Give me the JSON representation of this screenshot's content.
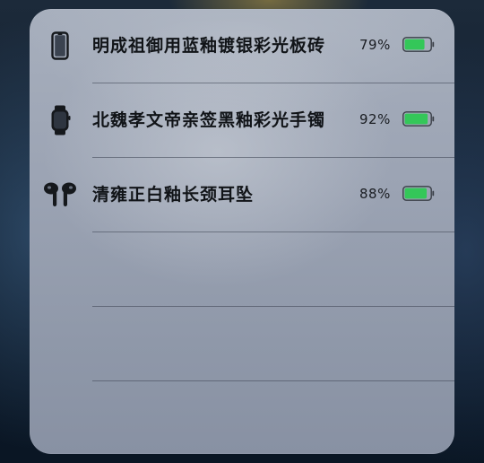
{
  "devices": [
    {
      "name": "明成祖御用蓝釉镀银彩光板砖",
      "percent": "79%",
      "level": 0.79,
      "icon": "iphone-icon"
    },
    {
      "name": "北魏孝文帝亲签黑釉彩光手镯",
      "percent": "92%",
      "level": 0.92,
      "icon": "apple-watch-icon"
    },
    {
      "name": "清雍正白釉长颈耳坠",
      "percent": "88%",
      "level": 0.88,
      "icon": "airpods-icon"
    }
  ],
  "empty_slots": 3,
  "colors": {
    "battery_fill": "#34c759",
    "battery_outline": "#3a3f47"
  }
}
